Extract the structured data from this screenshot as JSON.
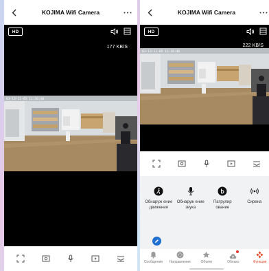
{
  "header": {
    "title": "KOJIMA Wifi Camera"
  },
  "left_view": {
    "quality": "HD",
    "data_rate": "177 KB/S",
    "timestamp": "03-13-11-05 11:36:40"
  },
  "right_view": {
    "quality": "HD",
    "data_rate": "222 KB/S",
    "timestamp": "03-13-11-05 11:36:46"
  },
  "controls": {
    "icons": [
      "fullscreen-icon",
      "snapshot-icon",
      "microphone-icon",
      "record-icon",
      "collapse-icon"
    ]
  },
  "features": [
    {
      "label": "Обнаруж ение движения",
      "icon": "motion-walk-icon"
    },
    {
      "label": "Обнаруж ение звука",
      "icon": "sound-mic-icon"
    },
    {
      "label": "Патрулир ование",
      "icon": "patrol-icon"
    },
    {
      "label": "Сирена",
      "icon": "siren-icon"
    }
  ],
  "tabs": [
    {
      "label": "Сообщения",
      "icon": "bell-icon",
      "active": false
    },
    {
      "label": "Направление",
      "icon": "direction-icon",
      "active": false
    },
    {
      "label": "Объект",
      "icon": "star-icon",
      "active": false
    },
    {
      "label": "Облако",
      "icon": "cloud-icon",
      "active": false
    },
    {
      "label": "Функции",
      "icon": "functions-icon",
      "active": true
    }
  ],
  "colors": {
    "accent": "#e04b2a",
    "edit_button": "#1e6fd0",
    "notification_dot": "#e53935"
  }
}
